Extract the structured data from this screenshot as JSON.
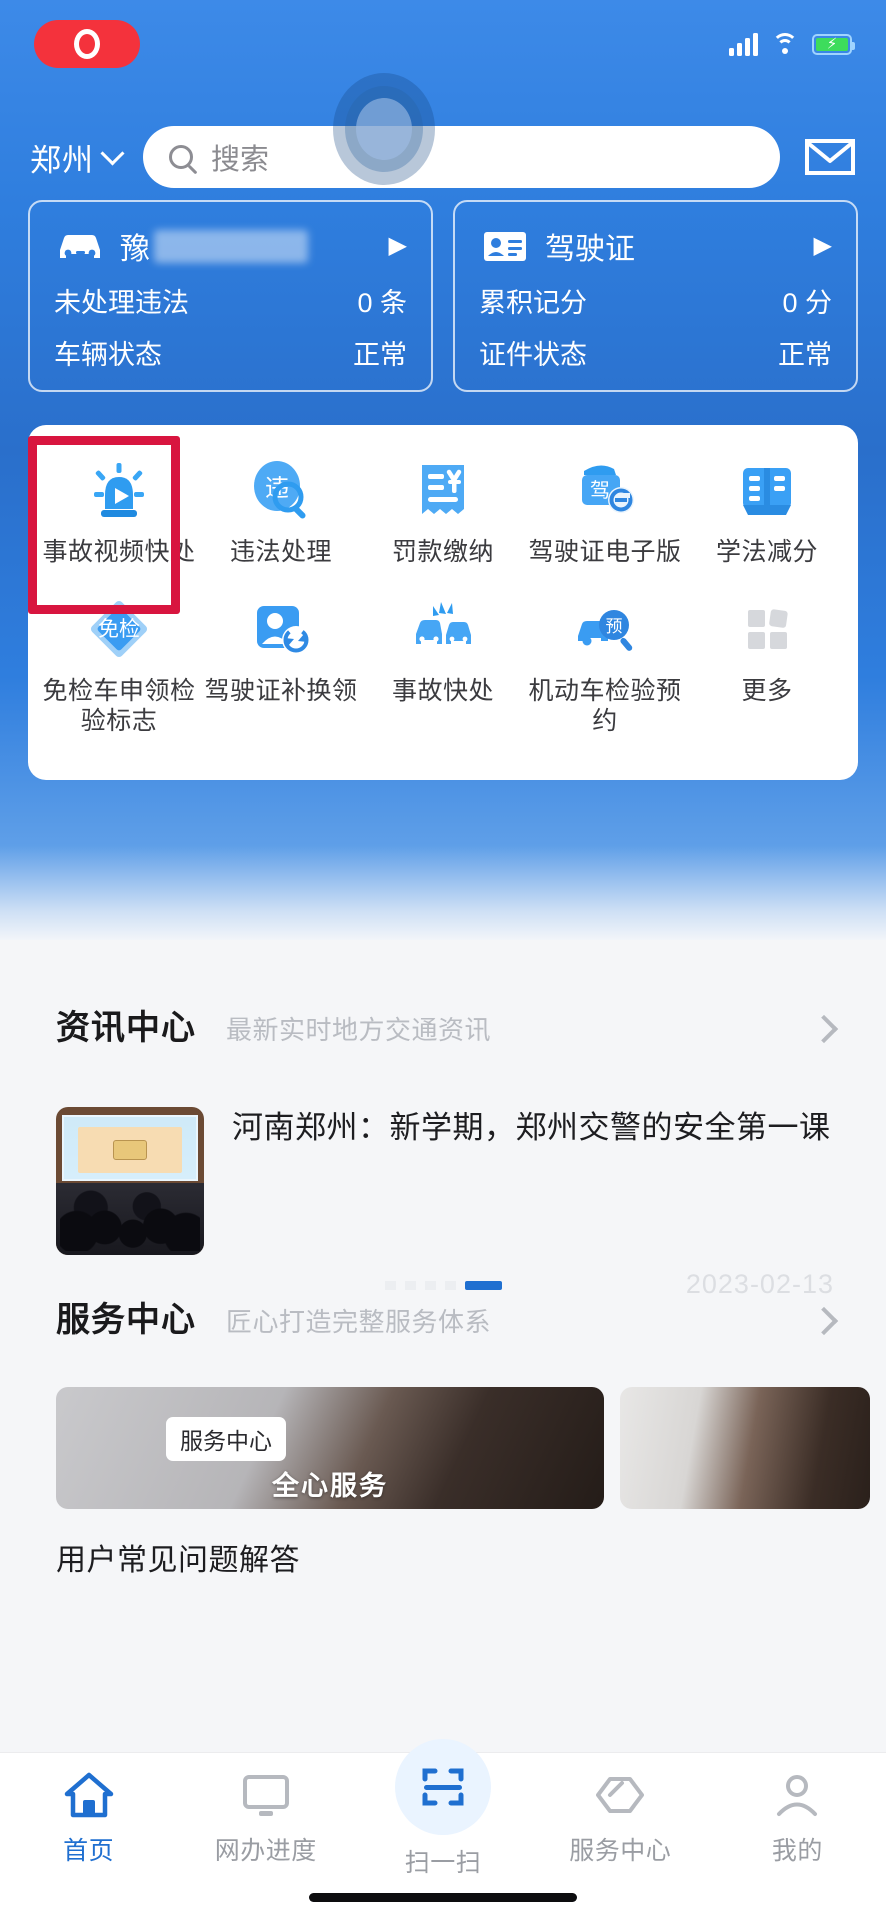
{
  "status_bar": {
    "recording_label": "rec",
    "signal_icon": "signal-bars-icon",
    "wifi_icon": "wifi-icon",
    "battery_icon": "battery-charging-icon"
  },
  "header": {
    "city": "郑州",
    "city_chevron": "chevron-down-icon",
    "search_placeholder": "搜索",
    "search_value": "",
    "search_icon": "search-icon",
    "mail_icon": "mail-icon"
  },
  "cards": [
    {
      "icon": "car-icon",
      "title_prefix": "豫",
      "title_masked": "AU34G7G",
      "arrow": "▶",
      "rows": [
        {
          "label": "未处理违法",
          "value": "0 条"
        },
        {
          "label": "车辆状态",
          "value": "正常"
        }
      ]
    },
    {
      "icon": "id-card-icon",
      "title_prefix": "驾驶证",
      "title_masked": "",
      "arrow": "▶",
      "rows": [
        {
          "label": "累积记分",
          "value": "0 分"
        },
        {
          "label": "证件状态",
          "value": "正常"
        }
      ]
    }
  ],
  "grid": {
    "items": [
      {
        "label": "事故视频快处",
        "icon": "alarm-beacon-video-icon",
        "highlighted": true
      },
      {
        "label": "违法处理",
        "icon": "violation-search-icon",
        "highlighted": false
      },
      {
        "label": "罚款缴纳",
        "icon": "receipt-yuan-icon",
        "highlighted": false
      },
      {
        "label": "驾驶证电子版",
        "icon": "license-e-icon",
        "highlighted": false
      },
      {
        "label": "学法减分",
        "icon": "open-book-icon",
        "highlighted": false
      },
      {
        "label": "免检车申领检验标志",
        "icon": "exempt-inspection-diamond-icon",
        "highlighted": false
      },
      {
        "label": "驾驶证补换领",
        "icon": "person-renew-icon",
        "highlighted": false
      },
      {
        "label": "事故快处",
        "icon": "car-collision-icon",
        "highlighted": false
      },
      {
        "label": "机动车检验预约",
        "icon": "vehicle-booking-icon",
        "highlighted": false
      },
      {
        "label": "更多",
        "icon": "more-squares-icon",
        "highlighted": false
      }
    ]
  },
  "news_section": {
    "title": "资讯中心",
    "subtitle": "最新实时地方交通资讯",
    "chevron": "chevron-right-icon",
    "article": {
      "title": "河南郑州：新学期，郑州交警的安全第一课",
      "date": "2023-02-13",
      "thumb": "classroom-photo"
    },
    "pager": {
      "total": 5,
      "active_index": 4
    }
  },
  "service_section": {
    "title": "服务中心",
    "subtitle": "匠心打造完整服务体系",
    "chevron": "chevron-right-icon",
    "banners": [
      {
        "chip": "服务中心",
        "caption": "全心服务",
        "image": "headset-agent-photo"
      },
      {
        "chip": "",
        "caption": "",
        "image": "agent-phone-photo"
      }
    ],
    "faq_label": "用户常见问题解答"
  },
  "tabbar": {
    "items": [
      {
        "label": "首页",
        "icon": "home-icon",
        "active": true
      },
      {
        "label": "网办进度",
        "icon": "monitor-icon",
        "active": false
      },
      {
        "label": "扫一扫",
        "icon": "scan-icon",
        "active": false
      },
      {
        "label": "服务中心",
        "icon": "handshake-icon",
        "active": false
      },
      {
        "label": "我的",
        "icon": "person-icon",
        "active": false
      }
    ]
  },
  "colors": {
    "brand_blue": "#2f7ede",
    "accent_blue": "#1f6fd0",
    "highlight_red": "#d8153f",
    "icon_blue": "#3aa0f5"
  }
}
